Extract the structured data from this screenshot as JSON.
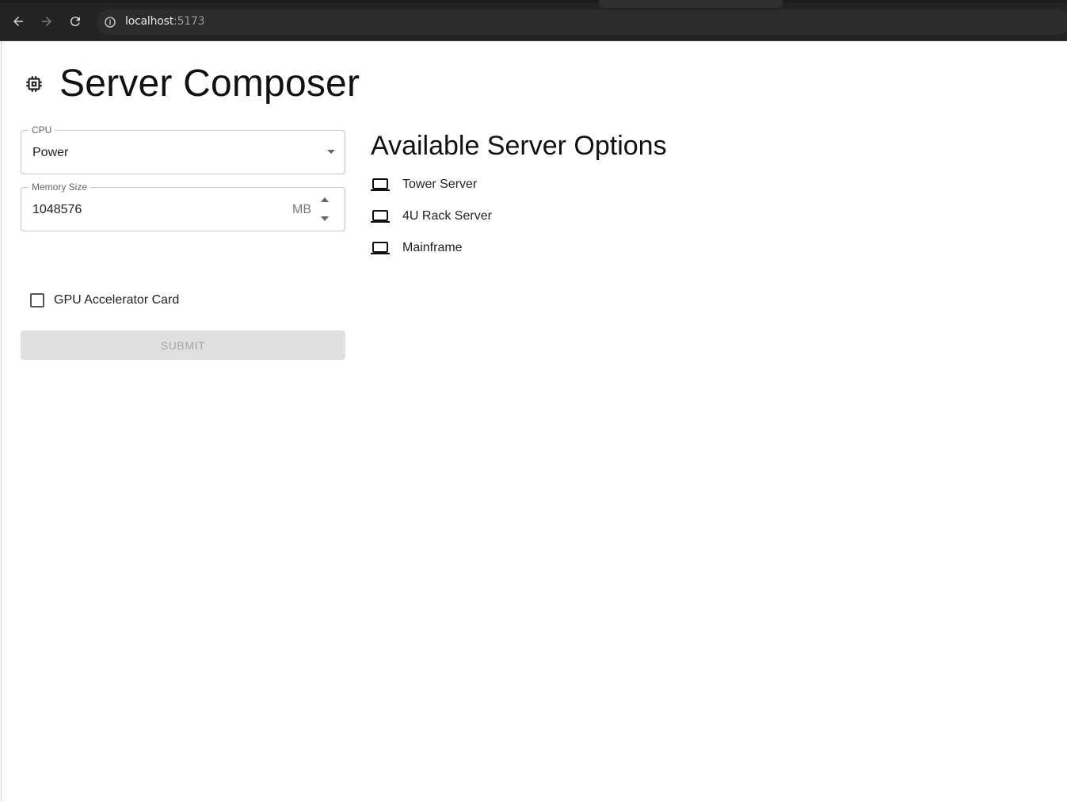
{
  "browser": {
    "url_host": "localhost",
    "url_port": ":5173"
  },
  "page": {
    "title": "Server Composer",
    "cpu": {
      "label": "CPU",
      "value": "Power"
    },
    "memory": {
      "label": "Memory Size",
      "value": "1048576",
      "unit": "MB"
    },
    "gpu": {
      "label": "GPU Accelerator Card",
      "checked": false
    },
    "submit_label": "SUBMIT",
    "options_heading": "Available Server Options",
    "options": [
      {
        "label": "Tower Server",
        "icon": "laptop-icon"
      },
      {
        "label": "4U Rack Server",
        "icon": "laptop-icon"
      },
      {
        "label": "Mainframe",
        "icon": "laptop-icon"
      }
    ]
  }
}
